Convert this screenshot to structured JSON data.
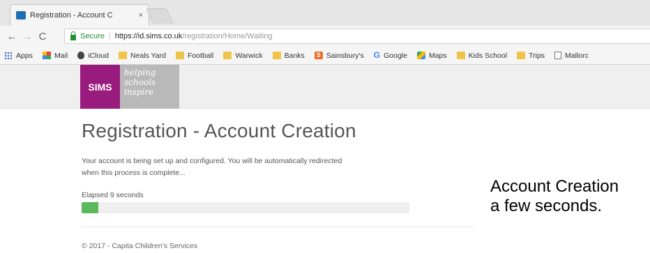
{
  "browser": {
    "tab": {
      "title": "Registration - Account C",
      "close": "×"
    },
    "nav": {
      "back": "←",
      "forward": "→",
      "reload": "C"
    },
    "address": {
      "secure_label": "Secure",
      "separator": "|",
      "host": "https://id.sims.co.uk",
      "path": "/registration/Home/Waiting"
    },
    "bookmarks": [
      {
        "label": "Apps",
        "icon": "apps-grid-icon"
      },
      {
        "label": "Mail",
        "icon": "mail-icon"
      },
      {
        "label": "iCloud",
        "icon": "apple-icon"
      },
      {
        "label": "Neals Yard",
        "icon": "folder-icon"
      },
      {
        "label": "Football",
        "icon": "folder-icon"
      },
      {
        "label": "Warwick",
        "icon": "folder-icon"
      },
      {
        "label": "Banks",
        "icon": "folder-icon"
      },
      {
        "label": "Sainsbury's",
        "icon": "sainsburys-icon",
        "glyph": "S"
      },
      {
        "label": "Google",
        "icon": "google-icon",
        "glyph": "G"
      },
      {
        "label": "Maps",
        "icon": "maps-icon"
      },
      {
        "label": "Kids School",
        "icon": "folder-icon"
      },
      {
        "label": "Trips",
        "icon": "folder-icon"
      },
      {
        "label": "Mallorc",
        "icon": "page-icon"
      }
    ]
  },
  "logo": {
    "brand": "SIMS",
    "tagline": [
      "helping",
      "schools",
      "inspire"
    ]
  },
  "page": {
    "title": "Registration - Account Creation",
    "message_line1": "Your account is being set up and configured. You will be automatically redirected",
    "message_line2": "when this process is complete...",
    "elapsed": "Elapsed 9 seconds",
    "progress_fraction": 0.05,
    "footer": "© 2017 - Capita Children's Services"
  },
  "caption": {
    "line1": "Account Creation",
    "line2": "a few seconds."
  },
  "colors": {
    "brand_purple": "#9a1b7e",
    "progress_green": "#5cb85c",
    "secure_green": "#1e8f33"
  }
}
